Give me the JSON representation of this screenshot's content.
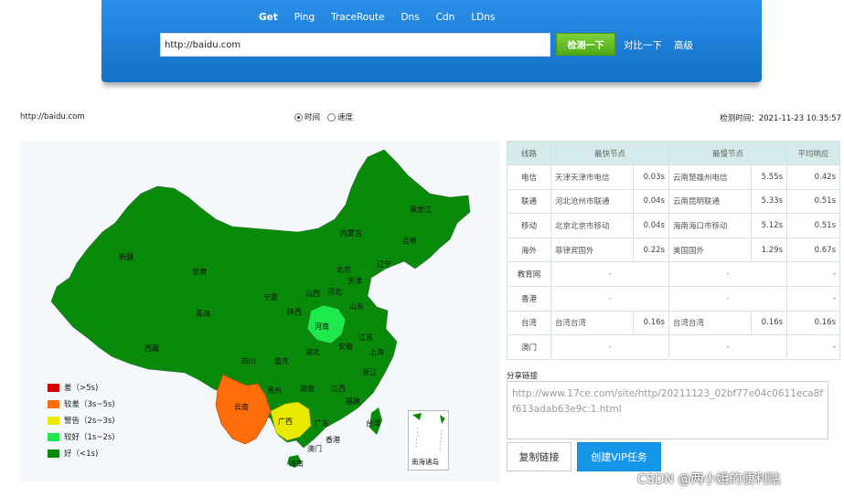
{
  "nav": {
    "tabs": [
      {
        "label": "Get",
        "active": true
      },
      {
        "label": "Ping",
        "active": false
      },
      {
        "label": "TraceRoute",
        "active": false
      },
      {
        "label": "Dns",
        "active": false
      },
      {
        "label": "Cdn",
        "active": false
      },
      {
        "label": "LDns",
        "active": false
      }
    ],
    "url_value": "http://baidu.com",
    "check_button": "检测一下",
    "compare_link": "对比一下",
    "advanced_link": "高级"
  },
  "info": {
    "url": "http://baidu.com",
    "radio_time": "时间",
    "radio_speed": "速度",
    "check_time": "检测时间：2021-11-23 10:35:57"
  },
  "map": {
    "labels": [
      "黑龙江",
      "吉林",
      "内蒙古",
      "辽宁",
      "北京",
      "天津",
      "河北",
      "新疆",
      "甘肃",
      "宁夏",
      "山西",
      "山东",
      "陕西",
      "河南",
      "青海",
      "江苏",
      "安徽",
      "湖北",
      "上海",
      "西藏",
      "四川",
      "重庆",
      "浙江",
      "贵州",
      "湖南",
      "江西",
      "福建",
      "云南",
      "广西",
      "广东",
      "台湾",
      "香港",
      "澳门",
      "海南",
      "南海诸岛"
    ],
    "legend": [
      {
        "label": "差（>5s)",
        "color": "#d40000"
      },
      {
        "label": "较差（3s~5s)",
        "color": "#ff6c0a"
      },
      {
        "label": "警告（2s~3s)",
        "color": "#e8e800"
      },
      {
        "label": "较好（1s~2s)",
        "color": "#1de84c"
      },
      {
        "label": "好（<1s)",
        "color": "#098a0b"
      }
    ]
  },
  "table": {
    "headers": [
      "线路",
      "最快节点",
      "最慢节点",
      "平均响应"
    ],
    "rows": [
      {
        "line": "电信",
        "fast_node": "天津天津市电信",
        "fast_time": "0.03s",
        "slow_node": "云南楚雄州电信",
        "slow_time": "5.55s",
        "avg": "0.42s"
      },
      {
        "line": "联通",
        "fast_node": "河北沧州市联通",
        "fast_time": "0.04s",
        "slow_node": "云南昆明联通",
        "slow_time": "5.33s",
        "avg": "0.51s"
      },
      {
        "line": "移动",
        "fast_node": "北京北京市移动",
        "fast_time": "0.04s",
        "slow_node": "海南海口市移动",
        "slow_time": "5.12s",
        "avg": "0.51s"
      },
      {
        "line": "海外",
        "fast_node": "菲律宾国外",
        "fast_time": "0.22s",
        "slow_node": "美国国外",
        "slow_time": "1.29s",
        "avg": "0.67s"
      },
      {
        "line": "教育网",
        "fast_node": "-",
        "fast_time": "",
        "slow_node": "-",
        "slow_time": "",
        "avg": "-"
      },
      {
        "line": "香港",
        "fast_node": "-",
        "fast_time": "",
        "slow_node": "-",
        "slow_time": "",
        "avg": "-"
      },
      {
        "line": "台湾",
        "fast_node": "台湾台湾",
        "fast_time": "0.16s",
        "slow_node": "台湾台湾",
        "slow_time": "0.16s",
        "avg": "0.16s"
      },
      {
        "line": "澳门",
        "fast_node": "-",
        "fast_time": "",
        "slow_node": "-",
        "slow_time": "",
        "avg": "-"
      }
    ]
  },
  "share": {
    "label": "分享链接",
    "link": "http://www.17ce.com/site/http/20211123_02bf77e04c0611eca8ff613adab63e9c:1.html",
    "copy_button": "复制链接",
    "vip_button": "创建VIP任务"
  },
  "watermark": "CSDN @两小姐的便利贴"
}
